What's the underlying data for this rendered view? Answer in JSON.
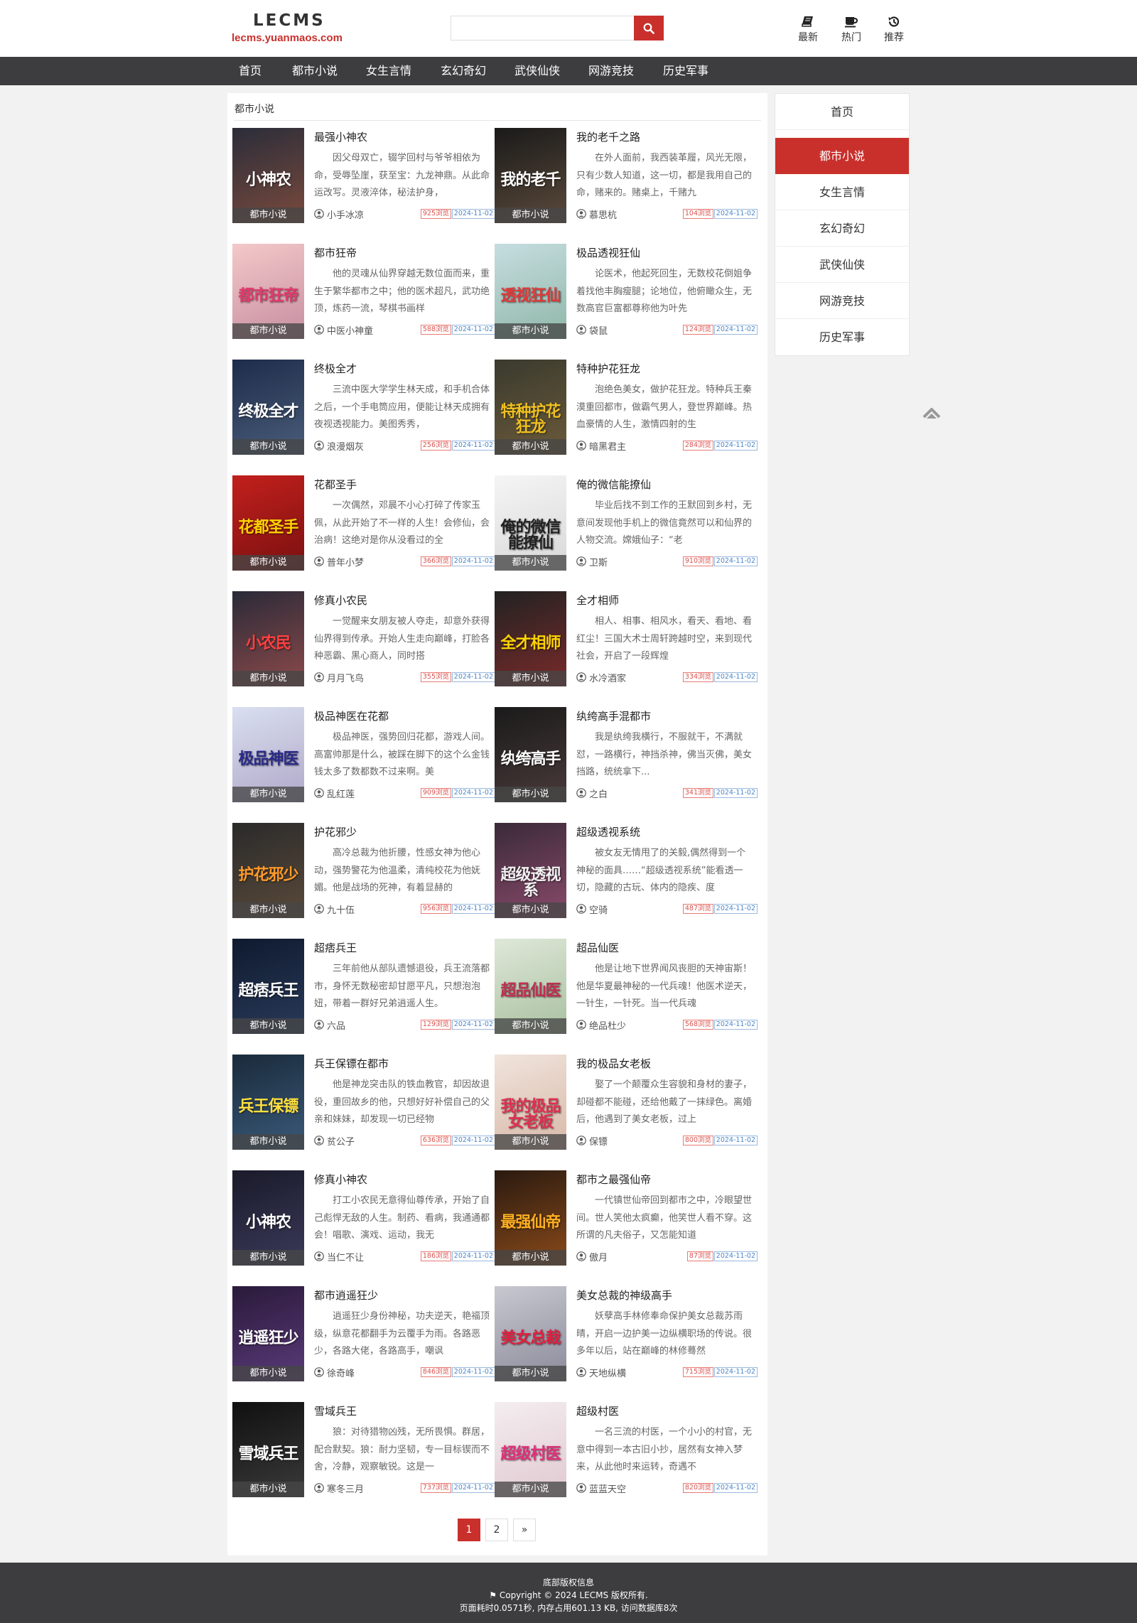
{
  "site": {
    "logo_text": "LECMS",
    "logo_domain": "lecms.yuanmaos.com",
    "search_placeholder": "",
    "header_links": [
      {
        "label": "最新",
        "icon": "book-icon"
      },
      {
        "label": "热门",
        "icon": "coffee-icon"
      },
      {
        "label": "推荐",
        "icon": "history-icon"
      }
    ]
  },
  "nav": [
    "首页",
    "都市小说",
    "女生言情",
    "玄幻奇幻",
    "武侠仙侠",
    "网游竞技",
    "历史军事"
  ],
  "breadcrumb": "都市小说",
  "books": [
    {
      "title": "最强小神农",
      "cover_text": "小神农",
      "desc": "因父母双亡，辍学回村与爷爷相依为命，受辱坠崖，获至宝：九龙神鼎。从此命运改写。灵液淬体，秘法护身，",
      "author": "小手冰凉",
      "views": "925浏览",
      "date": "2024-11-02",
      "category": "都市小说"
    },
    {
      "title": "我的老千之路",
      "cover_text": "我的老千",
      "desc": "在外人面前，我西装革履，风光无限，只有少数人知道，这一切，都是我用自己的命，赌来的。赌桌上，千赌九",
      "author": "慕思杭",
      "views": "104浏览",
      "date": "2024-11-02",
      "category": "都市小说"
    },
    {
      "title": "都市狂帝",
      "cover_text": "都市狂帝",
      "desc": "他的灵魂从仙界穿越无数位面而来，重生于繁华都市之中；他的医术超凡，武功绝顶，炼药一流，琴棋书画样",
      "author": "中医小神童",
      "views": "588浏览",
      "date": "2024-11-02",
      "category": "都市小说"
    },
    {
      "title": "极品透视狂仙",
      "cover_text": "透视狂仙",
      "desc": "论医术，他起死回生，无数校花倒姐争着找他丰胸瘦腿；论地位，他俯瞰众生，无数高官巨富都尊称他为叶先",
      "author": "袋鼠",
      "views": "124浏览",
      "date": "2024-11-02",
      "category": "都市小说"
    },
    {
      "title": "终极全才",
      "cover_text": "终极全才",
      "desc": "三流中医大学学生林天成，和手机合体之后，一个手电筒应用，便能让林天成拥有夜视透视能力。美图秀秀，",
      "author": "浪漫烟灰",
      "views": "256浏览",
      "date": "2024-11-02",
      "category": "都市小说"
    },
    {
      "title": "特种护花狂龙",
      "cover_text": "特种护花狂龙",
      "desc": "泡绝色美女，做护花狂龙。特种兵王秦漠重回都市，做霸气男人，登世界巅峰。热血豪情的人生，激情四射的生",
      "author": "暗黑君主",
      "views": "284浏览",
      "date": "2024-11-02",
      "category": "都市小说"
    },
    {
      "title": "花都圣手",
      "cover_text": "花都圣手",
      "desc": "一次偶然，邓晨不小心打碎了传家玉佩，从此开始了不一样的人生！会修仙，会治病！这绝对是你从没看过的全",
      "author": "普年小梦",
      "views": "366浏览",
      "date": "2024-11-02",
      "category": "都市小说"
    },
    {
      "title": "俺的微信能撩仙",
      "cover_text": "俺的微信能撩仙",
      "desc": "毕业后找不到工作的王默回到乡村，无意间发现他手机上的微信竟然可以和仙界的人物交流。嫦娥仙子：“老",
      "author": "卫斯",
      "views": "910浏览",
      "date": "2024-11-02",
      "category": "都市小说"
    },
    {
      "title": "修真小农民",
      "cover_text": "小农民",
      "desc": "一觉醒来女朋友被人夺走，却意外获得仙界得到传承。开始人生走向巅峰，打脸各种恶霸、黑心商人，同时搭",
      "author": "月月飞鸟",
      "views": "355浏览",
      "date": "2024-11-02",
      "category": "都市小说"
    },
    {
      "title": "全才相师",
      "cover_text": "全才相师",
      "desc": "相人、相事、相风水，看天、看地、看红尘！三国大术士周轩跨越时空，来到现代社会，开启了一段辉煌",
      "author": "水冷酒家",
      "views": "334浏览",
      "date": "2024-11-02",
      "category": "都市小说"
    },
    {
      "title": "极品神医在花都",
      "cover_text": "极品神医",
      "desc": "极品神医，强势回归花都，游戏人间。高富帅那是什么，被踩在脚下的这个么金钱钱太多了数都数不过来啊。美",
      "author": "乱红莲",
      "views": "909浏览",
      "date": "2024-11-02",
      "category": "都市小说"
    },
    {
      "title": "纨绔高手混都市",
      "cover_text": "纨绔高手",
      "desc": "我是纨绔我横行，不服就干，不满就怼，一路横行，神挡杀神，佛当灭佛，美女挡路，统统拿下...",
      "author": "之白",
      "views": "341浏览",
      "date": "2024-11-02",
      "category": "都市小说"
    },
    {
      "title": "护花邪少",
      "cover_text": "护花邪少",
      "desc": "高冷总裁为他折腰，性感女神为他心动，强势警花为他温柔，清纯校花为他妩媚。他是战场的死神，有着显赫的",
      "author": "九十伍",
      "views": "956浏览",
      "date": "2024-11-02",
      "category": "都市小说"
    },
    {
      "title": "超级透视系统",
      "cover_text": "超级透视系",
      "desc": "被女友无情甩了的关毅,偶然得到一个神秘的面具……“超级透视系统”能看透一切，隐藏的古玩、体内的隐疾、度",
      "author": "空骑",
      "views": "487浏览",
      "date": "2024-11-02",
      "category": "都市小说"
    },
    {
      "title": "超痞兵王",
      "cover_text": "超痞兵王",
      "desc": "三年前他从部队遗憾退役，兵王流落都市，身怀无数秘密却甘愿平凡，只想泡泡妞，带着一群好兄弟逍遥人生。",
      "author": "六品",
      "views": "129浏览",
      "date": "2024-11-02",
      "category": "都市小说"
    },
    {
      "title": "超品仙医",
      "cover_text": "超品仙医",
      "desc": "他是让地下世界闻风丧胆的天神宙斯！他是华夏最神秘的一代兵魂！他医术逆天，一针生，一针死。当一代兵魂",
      "author": "绝品杜少",
      "views": "568浏览",
      "date": "2024-11-02",
      "category": "都市小说"
    },
    {
      "title": "兵王保镖在都市",
      "cover_text": "兵王保镖",
      "desc": "他是神龙突击队的铁血教官，却因故退役，重回故乡的他，只想好好补偿自己的父亲和妹妹，却发现一切已经物",
      "author": "贫公子",
      "views": "636浏览",
      "date": "2024-11-02",
      "category": "都市小说"
    },
    {
      "title": "我的极品女老板",
      "cover_text": "我的极品女老板",
      "desc": "娶了一个颠覆众生容貌和身材的妻子，却碰都不能碰，还给他戴了一抹绿色。离婚后，他遇到了美女老板，过上",
      "author": "保镖",
      "views": "800浏览",
      "date": "2024-11-02",
      "category": "都市小说"
    },
    {
      "title": "修真小神农",
      "cover_text": "小神农",
      "desc": "打工小农民无意得仙尊传承，开始了自己彪悍无敌的人生。制药、看病，我通通都会！唱歌、演戏、运动，我无",
      "author": "当仁不让",
      "views": "186浏览",
      "date": "2024-11-02",
      "category": "都市小说"
    },
    {
      "title": "都市之最强仙帝",
      "cover_text": "最强仙帝",
      "desc": "一代镇世仙帝回到都市之中，冷眼望世间。世人笑他太疯癫，他笑世人看不穿。这所谓的凡夫俗子，又怎能知道",
      "author": "傲月",
      "views": "87浏览",
      "date": "2024-11-02",
      "category": "都市小说"
    },
    {
      "title": "都市逍遥狂少",
      "cover_text": "逍遥狂少",
      "desc": "逍遥狂少身份神秘，功夫逆天，艳福顶级，纵意花都翻手为云覆手为雨。各路恶少，各路大佬，各路高手，嘲讽",
      "author": "徐奇峰",
      "views": "846浏览",
      "date": "2024-11-02",
      "category": "都市小说"
    },
    {
      "title": "美女总裁的神级高手",
      "cover_text": "美女总裁",
      "desc": "妖孽高手林修奉命保护美女总裁苏雨晴，开启一边护美一边纵横职场的传说。很多年以后，站在巅峰的林修蓦然",
      "author": "天地纵横",
      "views": "715浏览",
      "date": "2024-11-02",
      "category": "都市小说"
    },
    {
      "title": "雪域兵王",
      "cover_text": "雪域兵王",
      "desc": "狼：对待猎物凶残，无所畏惧。群居，配合默契。狼：耐力坚韧，专一目标锲而不舍，冷静，观察敏锐。这是一",
      "author": "寒冬三月",
      "views": "737浏览",
      "date": "2024-11-02",
      "category": "都市小说"
    },
    {
      "title": "超级村医",
      "cover_text": "超级村医",
      "desc": "一名三流的村医，一个小小的村官，无意中得到一本古旧小抄，居然有女神入梦来，从此他时来运转，奇遇不",
      "author": "蓝蓝天空",
      "views": "820浏览",
      "date": "2024-11-02",
      "category": "都市小说"
    }
  ],
  "pagination": [
    "1",
    "2",
    "»"
  ],
  "sidebar": [
    "首页",
    "都市小说",
    "女生言情",
    "玄幻奇幻",
    "武侠仙侠",
    "网游竞技",
    "历史军事"
  ],
  "footer": {
    "line1": "底部版权信息",
    "line2": "Copyright © 2024 LECMS 版权所有.",
    "line3": "页面耗时0.0571秒, 内存占用601.13 KB, 访问数据库8次"
  },
  "colors": {
    "accent": "#c9302c",
    "nav_bg": "#3d3d3f"
  }
}
